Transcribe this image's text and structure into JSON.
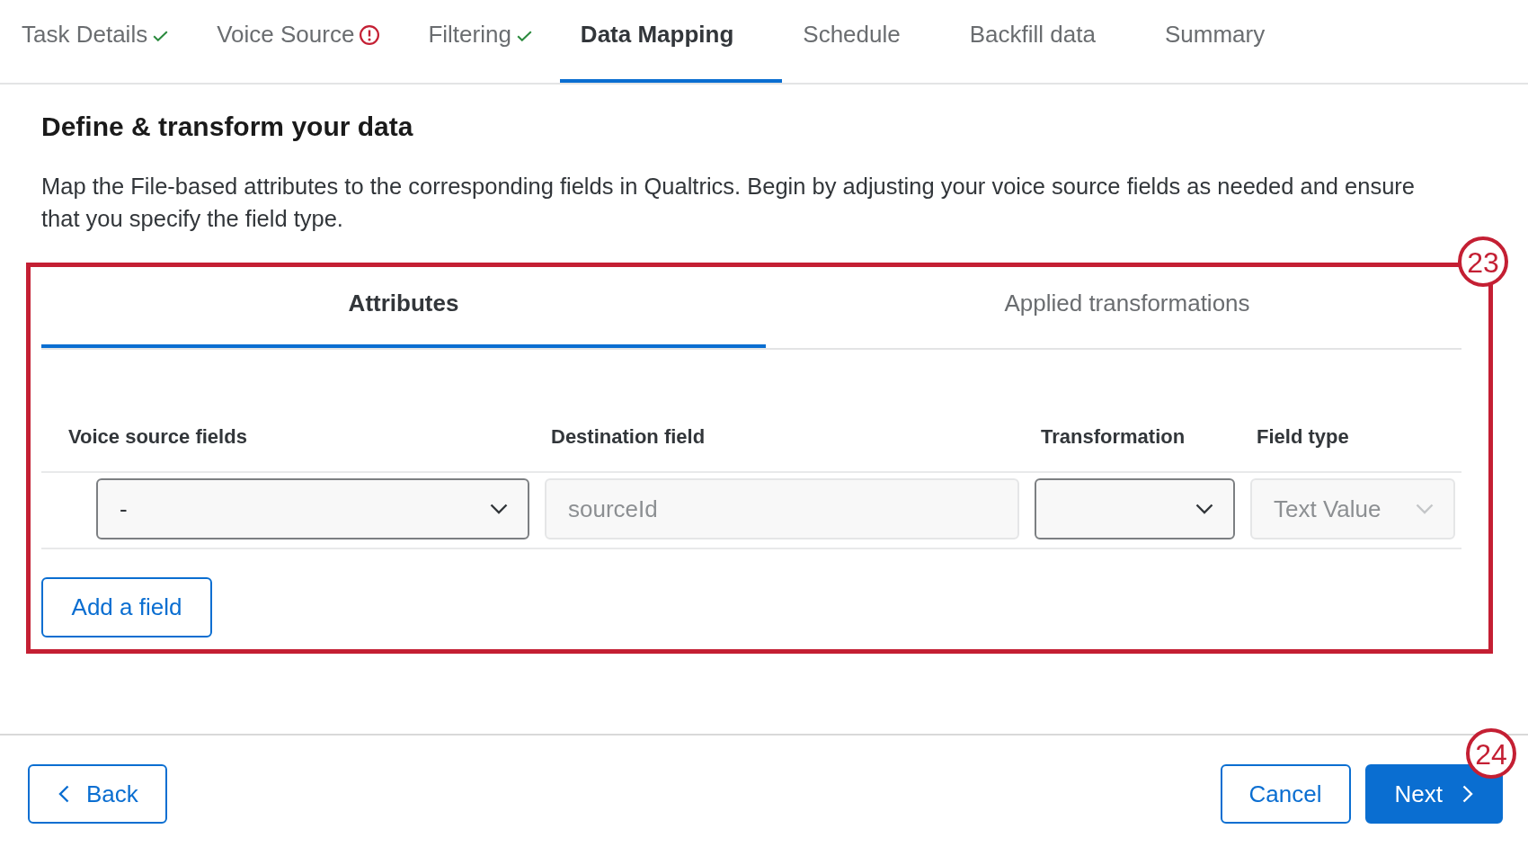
{
  "wizard_tabs": [
    {
      "label": "Task Details",
      "completed": true,
      "has_error": false,
      "selected": false
    },
    {
      "label": "Voice Source",
      "completed": false,
      "has_error": true,
      "selected": false
    },
    {
      "label": "Filtering",
      "completed": true,
      "has_error": false,
      "selected": false
    },
    {
      "label": "Data Mapping",
      "completed": false,
      "has_error": false,
      "selected": true
    },
    {
      "label": "Schedule",
      "completed": false,
      "has_error": false,
      "selected": false
    },
    {
      "label": "Backfill data",
      "completed": false,
      "has_error": false,
      "selected": false
    },
    {
      "label": "Summary",
      "completed": false,
      "has_error": false,
      "selected": false
    }
  ],
  "page": {
    "title": "Define & transform your data",
    "description": "Map the File-based attributes to the corresponding fields in Qualtrics. Begin by adjusting your voice source fields as needed and ensure that you specify the field type."
  },
  "mapping_panel": {
    "highlighted": true,
    "callout": "23",
    "tabs": [
      {
        "label": "Attributes",
        "selected": true
      },
      {
        "label": "Applied transformations",
        "selected": false
      }
    ],
    "table": {
      "columns": [
        "Voice source fields",
        "Destination field",
        "Transformation",
        "Field type"
      ],
      "rows": [
        {
          "cells": [
            {
              "kind": "select",
              "value": "-",
              "disabled": false
            },
            {
              "kind": "text",
              "value": "sourceId",
              "disabled": true
            },
            {
              "kind": "select",
              "disabled": false
            },
            {
              "kind": "select",
              "value": "Text Value",
              "disabled": true
            }
          ]
        }
      ]
    },
    "add_button": "Add a field"
  },
  "footer": {
    "back_button": "Back",
    "cancel_button": "Cancel",
    "next_button": {
      "label": "Next",
      "callout": "24"
    }
  }
}
